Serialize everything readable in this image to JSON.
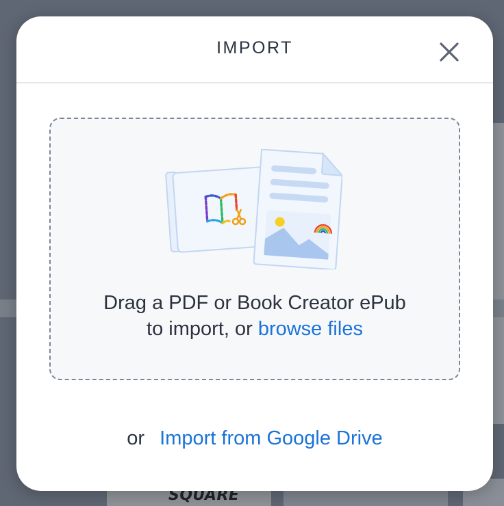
{
  "background": {
    "partial_card_text": "SQUARE"
  },
  "modal": {
    "title": "IMPORT",
    "close_icon": "close-icon",
    "dropzone": {
      "illustration_icon": "import-documents-illustration",
      "line1": "Drag a PDF or Book Creator ePub",
      "line2_prefix": "to import, or",
      "browse_link": "browse files"
    },
    "gdrive": {
      "or_label": "or",
      "link": "Import from Google Drive"
    }
  },
  "colors": {
    "link": "#1a73d9",
    "text": "#2b3240",
    "overlay": "#5f6774",
    "dropzone_bg": "#f7f8fa",
    "illustration_blue": "#a9c6ef"
  }
}
